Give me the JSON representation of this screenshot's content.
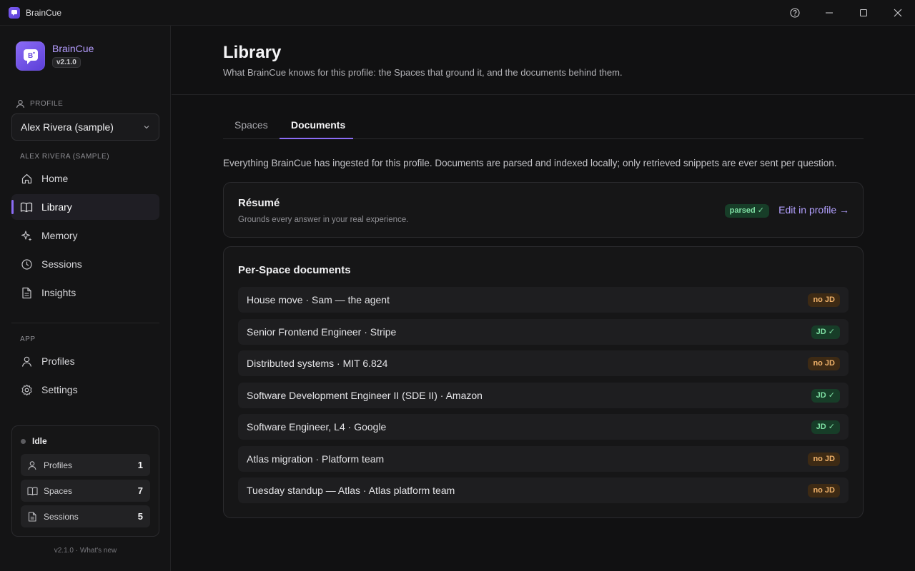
{
  "window": {
    "title": "BrainCue"
  },
  "brand": {
    "name": "BrainCue",
    "version": "v2.1.0"
  },
  "profile": {
    "section_label": "PROFILE",
    "selected": "Alex Rivera (sample)"
  },
  "nav": {
    "profile_section_label": "ALEX RIVERA (SAMPLE)",
    "items": [
      {
        "label": "Home",
        "icon": "home-icon"
      },
      {
        "label": "Library",
        "icon": "book-icon",
        "active": true
      },
      {
        "label": "Memory",
        "icon": "sparkle-icon"
      },
      {
        "label": "Sessions",
        "icon": "clock-icon"
      },
      {
        "label": "Insights",
        "icon": "document-icon"
      }
    ],
    "app_section_label": "APP",
    "app_items": [
      {
        "label": "Profiles",
        "icon": "user-icon"
      },
      {
        "label": "Settings",
        "icon": "gear-icon"
      }
    ]
  },
  "status": {
    "state": "Idle",
    "rows": [
      {
        "label": "Profiles",
        "count": "1"
      },
      {
        "label": "Spaces",
        "count": "7"
      },
      {
        "label": "Sessions",
        "count": "5"
      }
    ]
  },
  "footer": {
    "text": "v2.1.0 · What's new"
  },
  "page": {
    "title": "Library",
    "subtitle": "What BrainCue knows for this profile: the Spaces that ground it, and the documents behind them.",
    "tabs": [
      {
        "label": "Spaces"
      },
      {
        "label": "Documents",
        "active": true
      }
    ],
    "description": "Everything BrainCue has ingested for this profile. Documents are parsed and indexed locally; only retrieved snippets are ever sent per question."
  },
  "resume": {
    "title": "Résumé",
    "subtitle": "Grounds every answer in your real experience.",
    "badge": "parsed ✓",
    "edit_link": "Edit in profile →"
  },
  "per_space": {
    "title": "Per-Space documents",
    "rows": [
      {
        "label": "House move · Sam — the agent",
        "badge": "no JD",
        "status": "warn"
      },
      {
        "label": "Senior Frontend Engineer · Stripe",
        "badge": "JD ✓",
        "status": "ok"
      },
      {
        "label": "Distributed systems · MIT 6.824",
        "badge": "no JD",
        "status": "warn"
      },
      {
        "label": "Software Development Engineer II (SDE II) · Amazon",
        "badge": "JD ✓",
        "status": "ok"
      },
      {
        "label": "Software Engineer, L4 · Google",
        "badge": "JD ✓",
        "status": "ok"
      },
      {
        "label": "Atlas migration · Platform team",
        "badge": "no JD",
        "status": "warn"
      },
      {
        "label": "Tuesday standup — Atlas · Atlas platform team",
        "badge": "no JD",
        "status": "warn"
      }
    ]
  },
  "colors": {
    "accent": "#8b6cf5",
    "ok": "#7fe0a4",
    "warn": "#f0b26a",
    "background": "#111112"
  }
}
